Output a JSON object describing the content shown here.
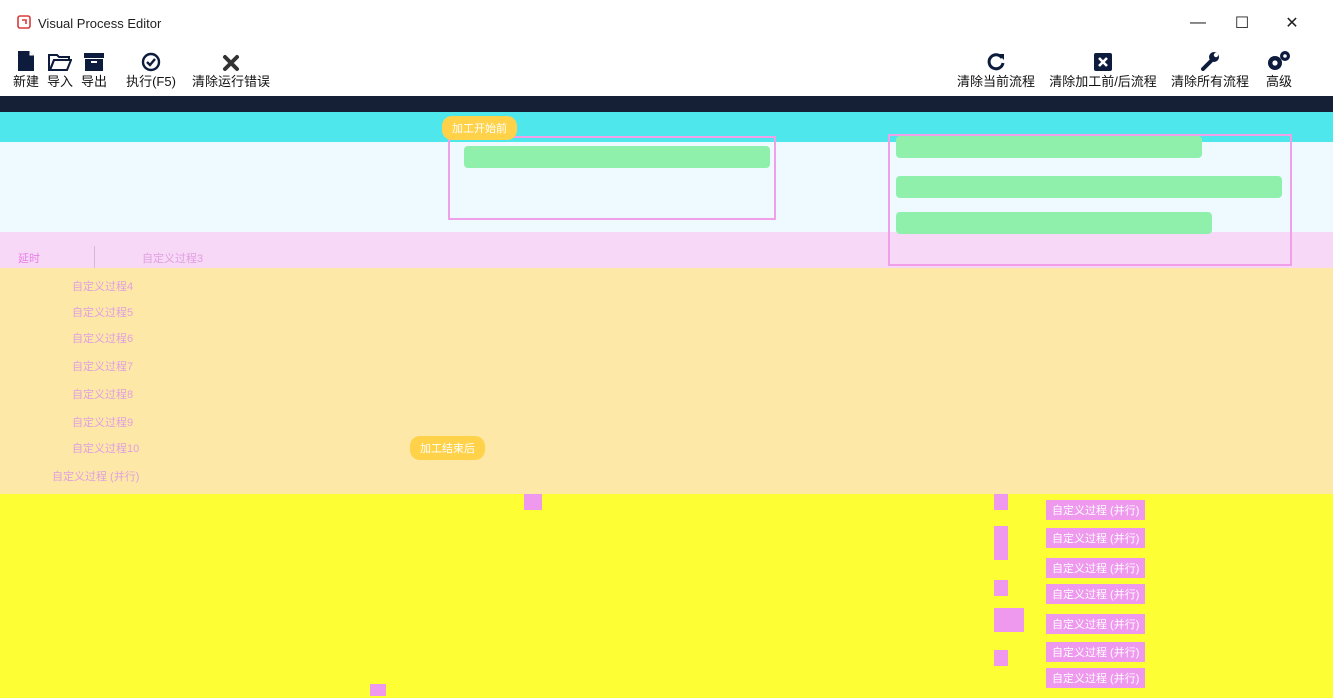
{
  "window": {
    "title": "Visual Process Editor",
    "controls": {
      "minimize": "—",
      "maximize": "☐",
      "close": "✕"
    }
  },
  "toolbar": {
    "left": [
      {
        "id": "new",
        "label": "新建",
        "icon": "new-file-icon"
      },
      {
        "id": "import",
        "label": "导入",
        "icon": "open-folder-icon"
      },
      {
        "id": "export",
        "label": "导出",
        "icon": "archive-box-icon"
      },
      {
        "id": "run",
        "label": "执行(F5)",
        "icon": "check-circle-icon"
      },
      {
        "id": "clear-errors",
        "label": "清除运行错误",
        "icon": "x-mark-icon"
      }
    ],
    "right": [
      {
        "id": "clear-current",
        "label": "清除当前流程",
        "icon": "refresh-icon"
      },
      {
        "id": "clear-pre-post",
        "label": "清除加工前/后流程",
        "icon": "close-square-icon"
      },
      {
        "id": "clear-all",
        "label": "清除所有流程",
        "icon": "wrench-icon"
      },
      {
        "id": "advanced",
        "label": "高级",
        "icon": "gears-icon"
      }
    ]
  },
  "canvas": {
    "delay_label": "延时",
    "block_pre_process": "加工开始前",
    "block_post_process": "加工结束后",
    "tree_items": [
      "自定义过程3",
      "自定义过程4",
      "自定义过程5",
      "自定义过程6",
      "自定义过程7",
      "自定义过程8",
      "自定义过程9",
      "自定义过程10"
    ],
    "tree_group": "自定义过程 (并行)",
    "right_side_items": [
      "自定义过程 (并行)",
      "自定义过程 (并行)",
      "自定义过程 (并行)",
      "自定义过程 (并行)",
      "自定义过程 (并行)",
      "自定义过程 (并行)",
      "自定义过程 (并行)"
    ],
    "colors": {
      "dark": "#152036",
      "cyan": "#4ee8ec",
      "ice": "#eefaff",
      "pink": "#f7d8f6",
      "cream": "#fde8a8",
      "yellow": "#fefe34",
      "orange_block": "#ffd24a",
      "green_block": "#8ff0ac"
    }
  }
}
